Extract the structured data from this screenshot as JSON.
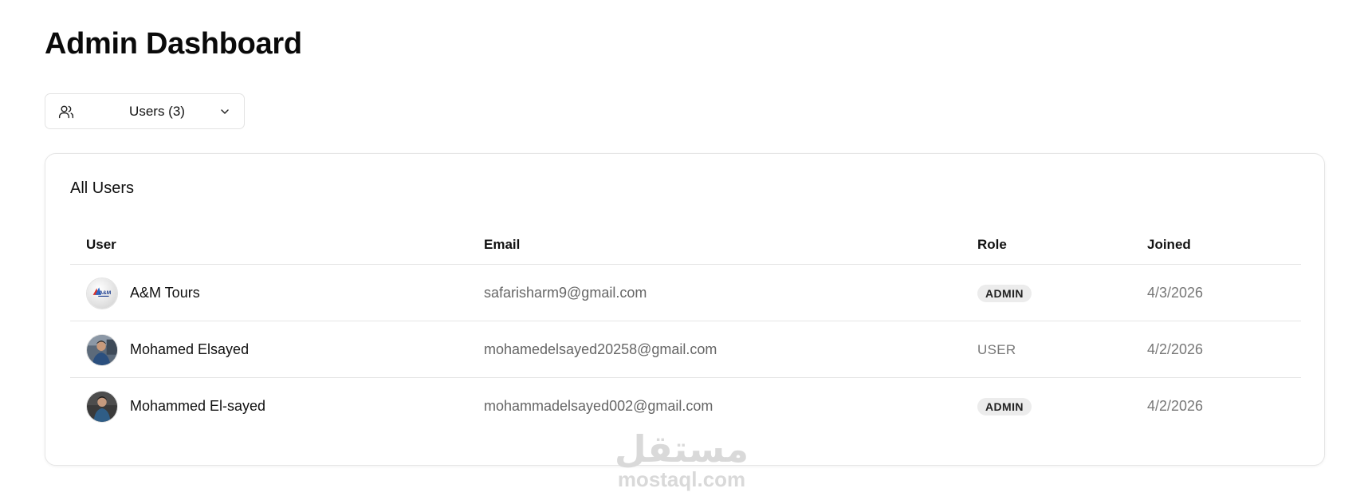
{
  "page": {
    "title": "Admin Dashboard"
  },
  "view_select": {
    "label": "Users (3)"
  },
  "users_card": {
    "title": "All Users",
    "columns": {
      "user": "User",
      "email": "Email",
      "role": "Role",
      "joined": "Joined"
    },
    "rows": [
      {
        "name": "A&M Tours",
        "email": "safarisharm9@gmail.com",
        "role": "ADMIN",
        "joined": "4/3/2026",
        "avatar_logo": "A&M"
      },
      {
        "name": "Mohamed Elsayed",
        "email": "mohamedelsayed20258@gmail.com",
        "role": "USER",
        "joined": "4/2/2026"
      },
      {
        "name": "Mohammed El-sayed",
        "email": "mohammadelsayed002@gmail.com",
        "role": "ADMIN",
        "joined": "4/2/2026"
      }
    ]
  },
  "watermark": {
    "arabic": "مستقل",
    "latin": "mostaql.com"
  },
  "colors": {
    "badge_bg": "#ececec",
    "border": "#e5e5e5",
    "muted_text": "#666666"
  }
}
